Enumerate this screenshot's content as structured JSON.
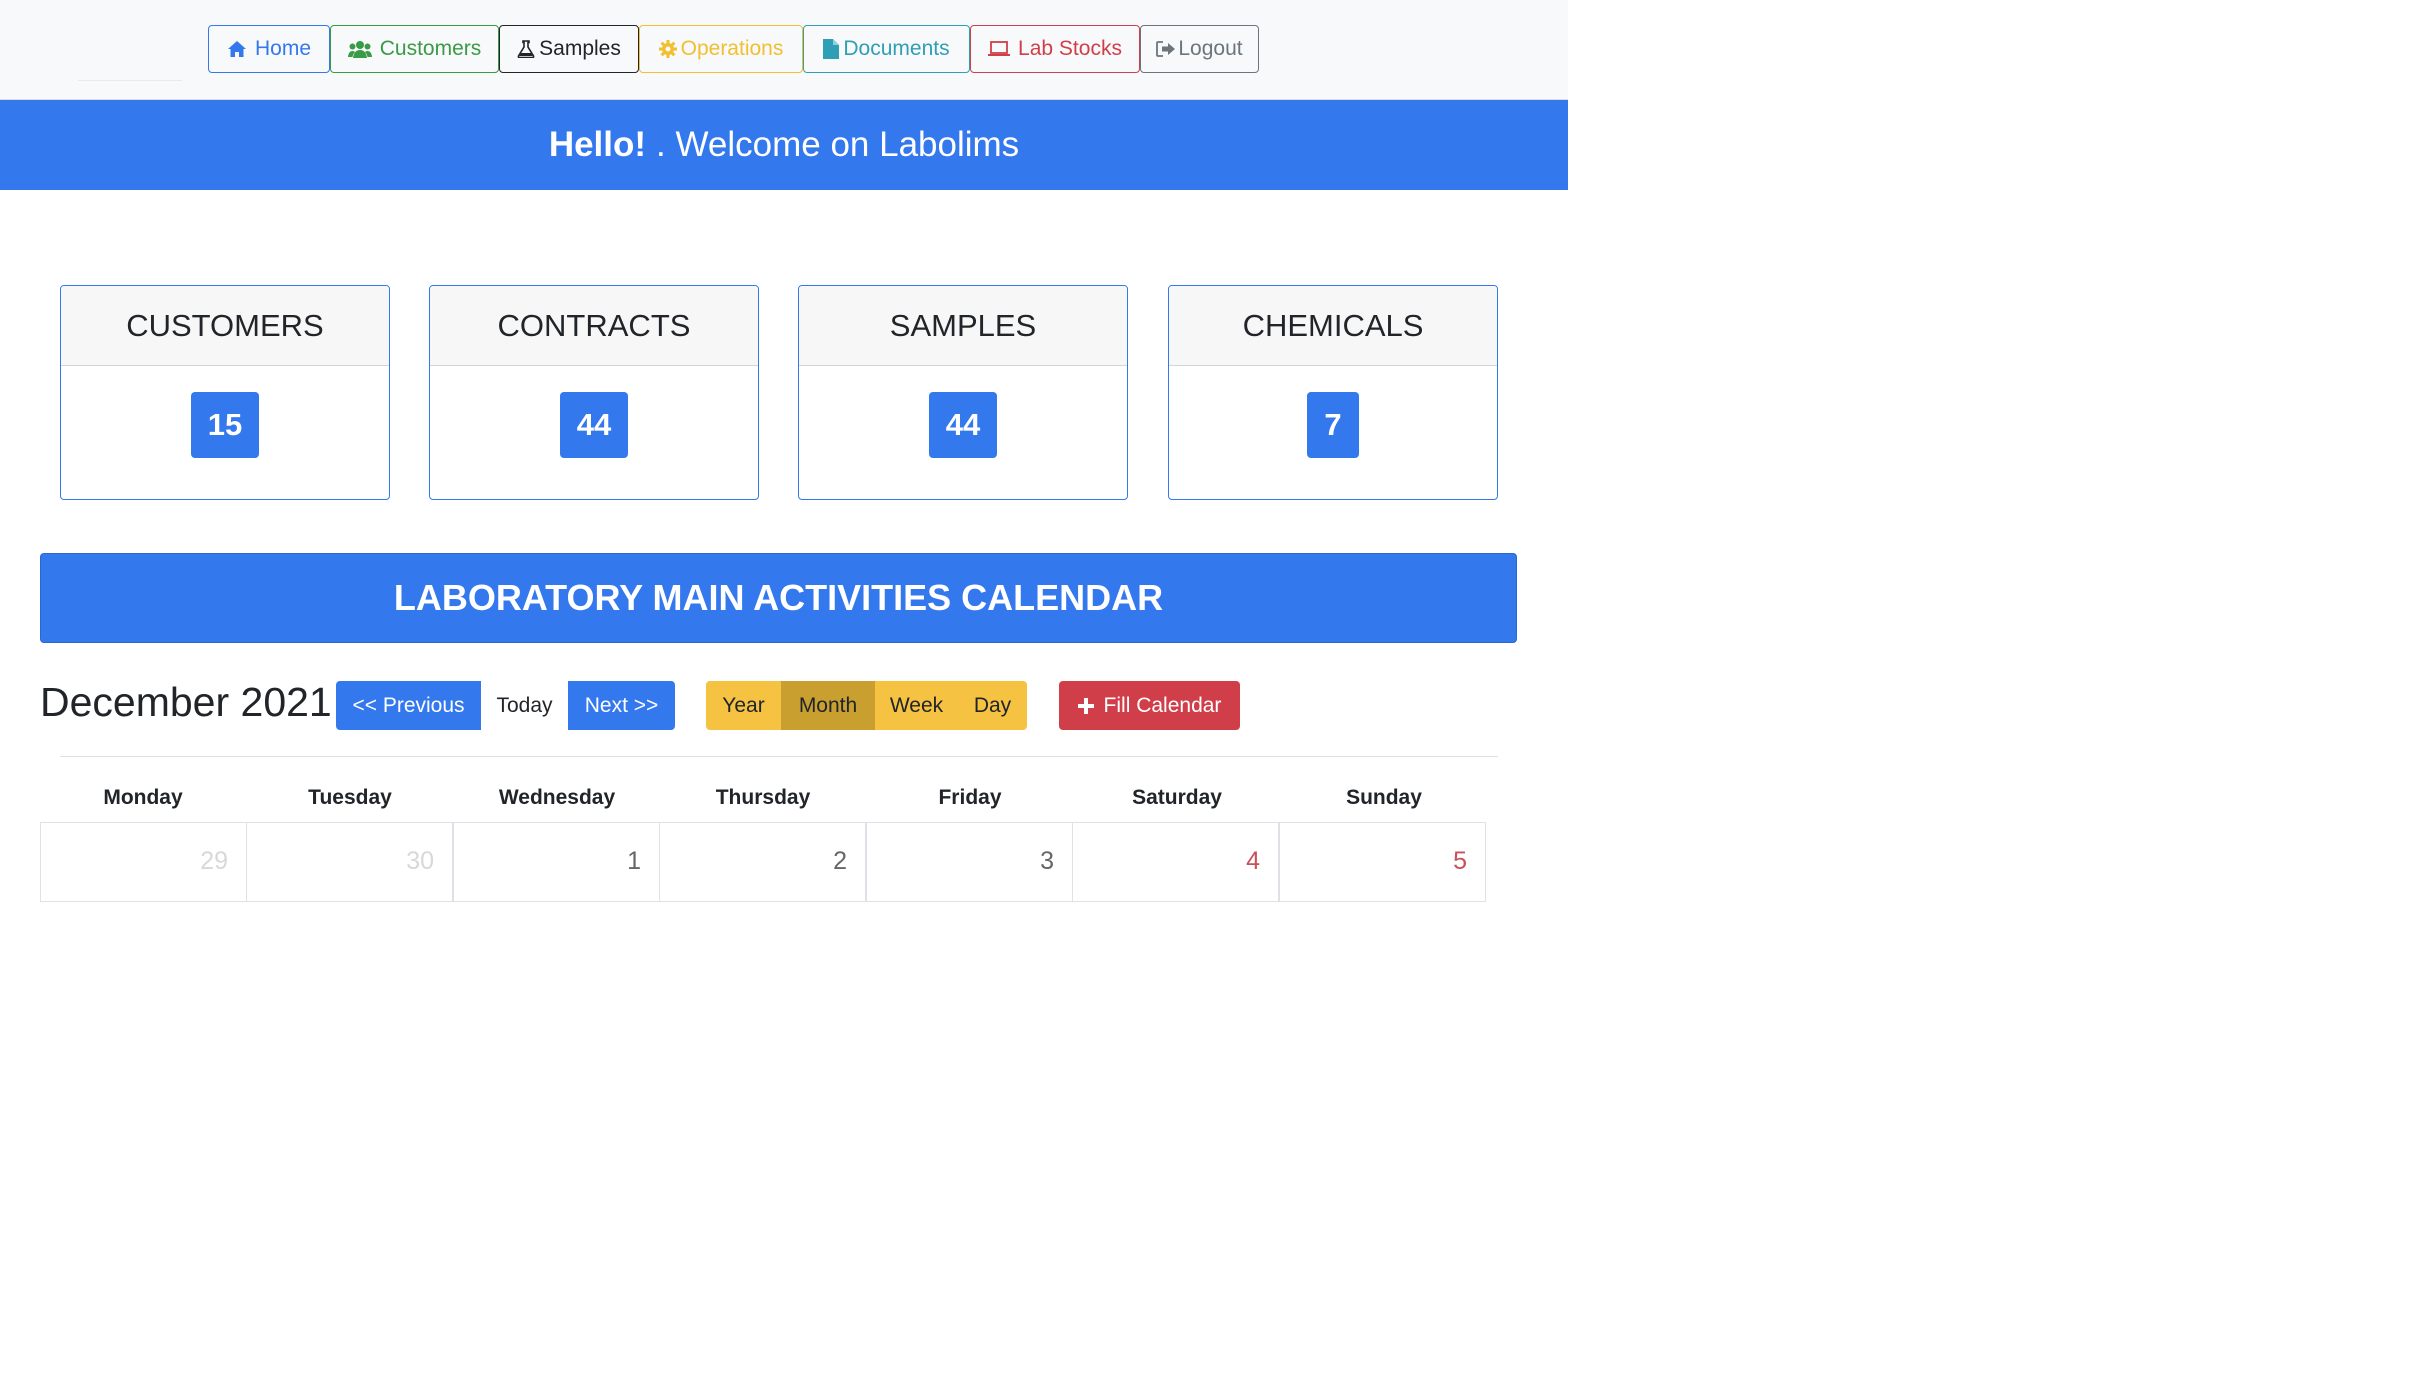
{
  "nav": {
    "items": [
      {
        "label": "Home",
        "icon": "home-icon",
        "color": "#3478ee"
      },
      {
        "label": "Customers",
        "icon": "users-icon",
        "color": "#3a9a45"
      },
      {
        "label": "Samples",
        "icon": "flask-icon",
        "color": "#212529"
      },
      {
        "label": "Operations",
        "icon": "gear-icon",
        "color": "#f0c030"
      },
      {
        "label": "Documents",
        "icon": "file-icon",
        "color": "#2e9fb4"
      },
      {
        "label": "Lab Stocks",
        "icon": "laptop-icon",
        "color": "#d03f49"
      },
      {
        "label": "Logout",
        "icon": "sign-out-icon",
        "color": "#6c757d"
      }
    ]
  },
  "welcome": {
    "hello": "Hello!",
    "text": ". Welcome on Labolims"
  },
  "stats": [
    {
      "label": "CUSTOMERS",
      "value": "15"
    },
    {
      "label": "CONTRACTS",
      "value": "44"
    },
    {
      "label": "SAMPLES",
      "value": "44"
    },
    {
      "label": "CHEMICALS",
      "value": "7"
    }
  ],
  "calendar": {
    "banner": "LABORATORY MAIN ACTIVITIES CALENDAR",
    "month_title": "December 2021",
    "prev_label": "<< Previous",
    "today_label": "Today",
    "next_label": "Next >>",
    "views": [
      "Year",
      "Month",
      "Week",
      "Day"
    ],
    "active_view": "Month",
    "fill_label": "Fill Calendar",
    "weekdays": [
      "Monday",
      "Tuesday",
      "Wednesday",
      "Thursday",
      "Friday",
      "Saturday",
      "Sunday"
    ],
    "first_week": [
      "29",
      "30",
      "1",
      "2",
      "3",
      "4",
      "5"
    ]
  },
  "colors": {
    "primary": "#3478ee",
    "warning": "#f5c242",
    "danger": "#d03f49"
  }
}
